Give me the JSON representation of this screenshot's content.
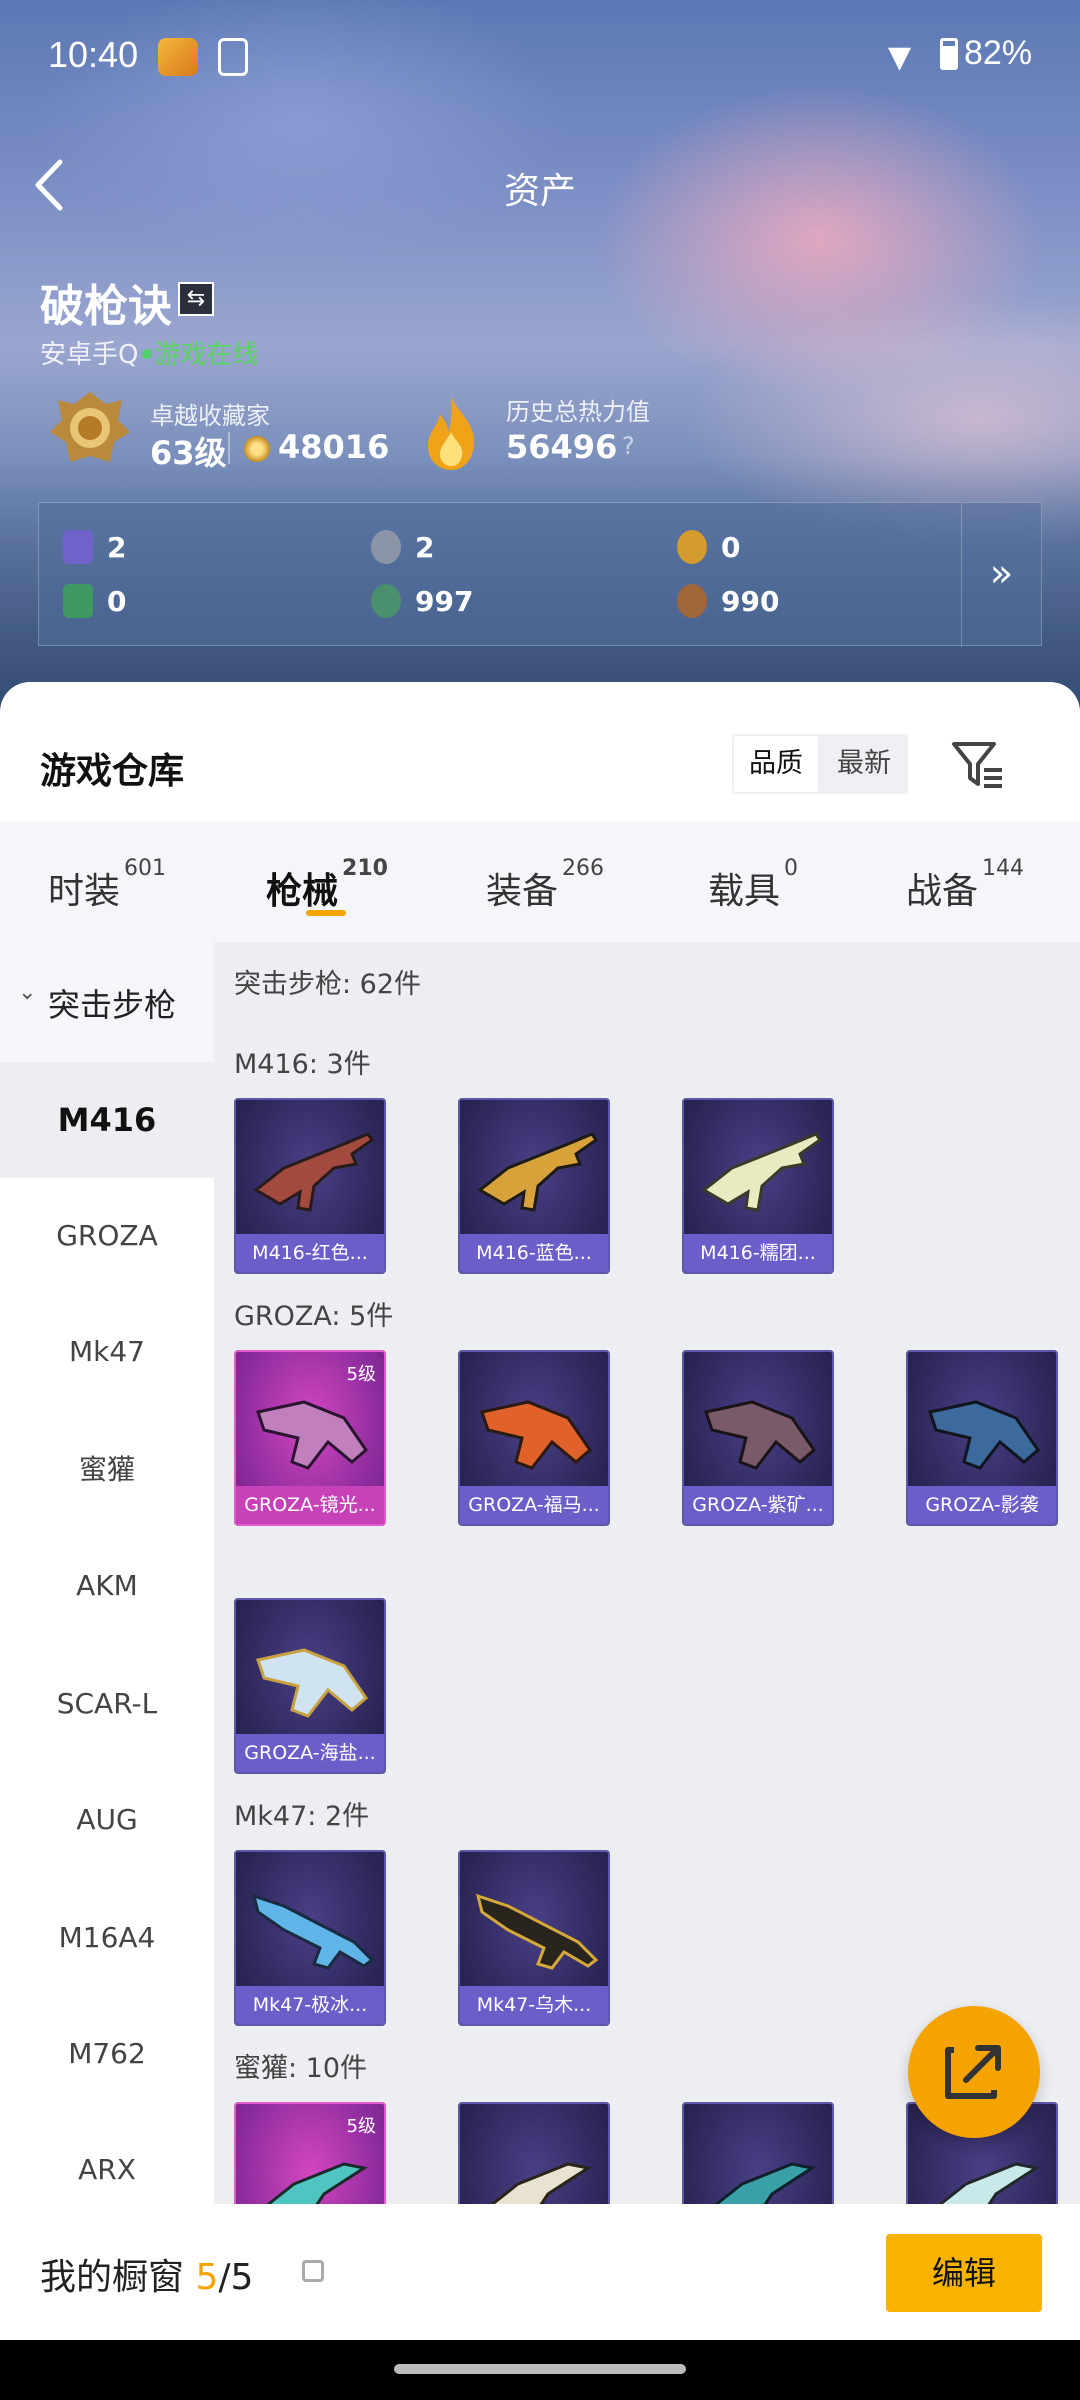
{
  "status": {
    "time": "10:40",
    "battery": "82%"
  },
  "header": {
    "title": "资产"
  },
  "profile": {
    "name": "破枪诀",
    "platform": "安卓手Q",
    "online": "游戏在线",
    "rank_title": "卓越收藏家",
    "rank_level": "63级",
    "coin_value": "48016",
    "heat_title": "历史总热力值",
    "heat_value": "56496",
    "heat_help": "?"
  },
  "currencies": [
    {
      "icon": "purple-card-icon",
      "value": "2",
      "color": "#6f63c9"
    },
    {
      "icon": "silver-badge-icon",
      "value": "2",
      "color": "#8c94a8"
    },
    {
      "icon": "gold-badge-icon",
      "value": "0",
      "color": "#d39a2c"
    },
    {
      "icon": "green-card-icon",
      "value": "0",
      "color": "#3f9a62"
    },
    {
      "icon": "green-orb-icon",
      "value": "997",
      "color": "#4a8f6e"
    },
    {
      "icon": "bronze-orb-icon",
      "value": "990",
      "color": "#a0663a"
    }
  ],
  "warehouse": {
    "title": "游戏仓库",
    "sort": [
      "品质",
      "最新"
    ],
    "tabs": [
      {
        "label": "时装",
        "count": "601"
      },
      {
        "label": "枪械",
        "count": "210"
      },
      {
        "label": "装备",
        "count": "266"
      },
      {
        "label": "载具",
        "count": "0"
      },
      {
        "label": "战备",
        "count": "144"
      }
    ],
    "category": "突击步枪",
    "sidebar": [
      "M416",
      "GROZA",
      "Mk47",
      "蜜獾",
      "AKM",
      "SCAR-L",
      "AUG",
      "M16A4",
      "M762",
      "ARX"
    ],
    "summary": "突击步枪: 62件",
    "sections": [
      {
        "title": "M416: 3件",
        "items": [
          {
            "name": "M416-红色...",
            "rarity": "purple",
            "level": ""
          },
          {
            "name": "M416-蓝色...",
            "rarity": "purple",
            "level": ""
          },
          {
            "name": "M416-糯团...",
            "rarity": "purple",
            "level": ""
          }
        ]
      },
      {
        "title": "GROZA: 5件",
        "items": [
          {
            "name": "GROZA-镜光...",
            "rarity": "pink",
            "level": "5级"
          },
          {
            "name": "GROZA-福马...",
            "rarity": "purple",
            "level": ""
          },
          {
            "name": "GROZA-紫矿...",
            "rarity": "purple",
            "level": ""
          },
          {
            "name": "GROZA-影袭",
            "rarity": "purple",
            "level": ""
          },
          {
            "name": "GROZA-海盐...",
            "rarity": "purple",
            "level": ""
          }
        ]
      },
      {
        "title": "Mk47: 2件",
        "items": [
          {
            "name": "Mk47-极冰...",
            "rarity": "purple",
            "level": ""
          },
          {
            "name": "Mk47-乌木...",
            "rarity": "purple",
            "level": ""
          }
        ]
      },
      {
        "title": "蜜獾: 10件",
        "items": [
          {
            "name": "",
            "rarity": "pink",
            "level": "5级"
          },
          {
            "name": "",
            "rarity": "purple",
            "level": ""
          },
          {
            "name": "",
            "rarity": "purple",
            "level": ""
          },
          {
            "name": "",
            "rarity": "purple",
            "level": ""
          }
        ]
      }
    ]
  },
  "showcase": {
    "label": "我的橱窗",
    "current": "5",
    "total": "/5",
    "edit": "编辑"
  }
}
